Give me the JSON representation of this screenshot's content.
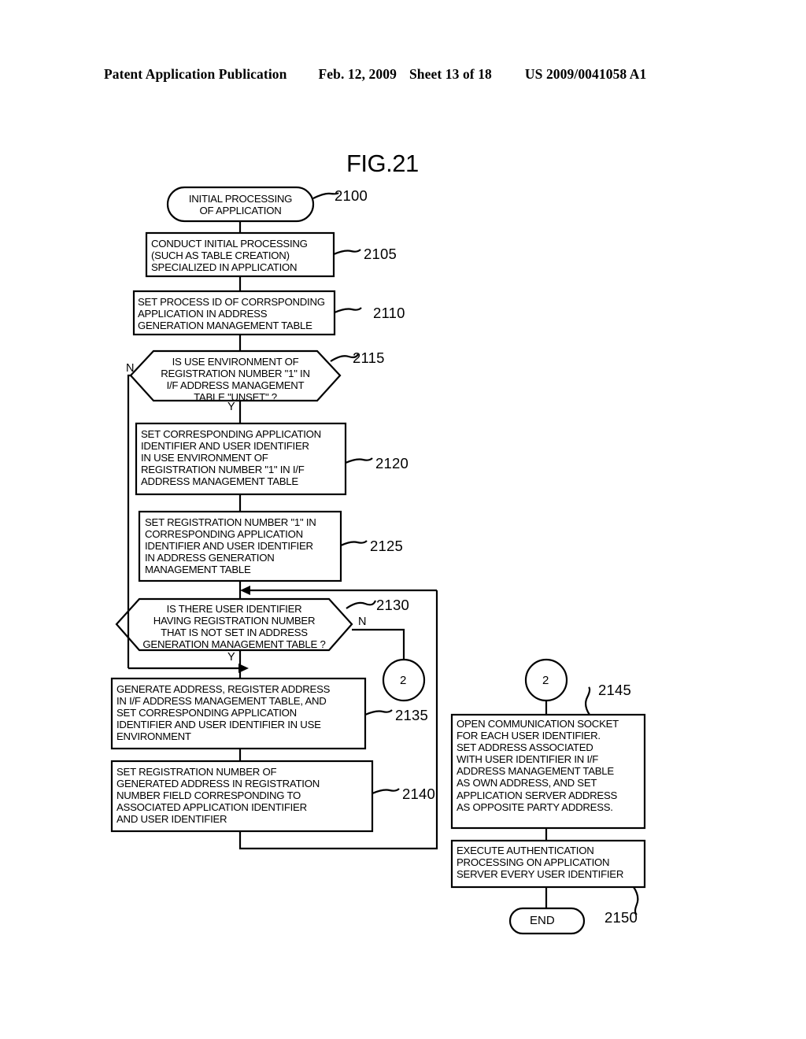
{
  "header": {
    "publication": "Patent Application Publication",
    "date": "Feb. 12, 2009",
    "sheet": "Sheet 13 of 18",
    "doc_number": "US 2009/0041058 A1"
  },
  "figure": {
    "title": "FIG.21",
    "nodes": {
      "start": {
        "ref": "2100",
        "shape": "terminator",
        "text": "INITIAL PROCESSING\nOF APPLICATION"
      },
      "step_2105": {
        "ref": "2105",
        "shape": "process",
        "text": "CONDUCT INITIAL PROCESSING\n(SUCH AS TABLE CREATION)\nSPECIALIZED IN APPLICATION"
      },
      "step_2110": {
        "ref": "2110",
        "shape": "process",
        "text": "SET PROCESS ID OF CORRSPONDING\nAPPLICATION IN ADDRESS\nGENERATION MANAGEMENT TABLE"
      },
      "decision_2115": {
        "ref": "2115",
        "shape": "decision",
        "text": "IS USE ENVIRONMENT OF\nREGISTRATION NUMBER \"1\" IN\nI/F ADDRESS MANAGEMENT\nTABLE \"UNSET\" ?",
        "yes_label": "Y",
        "no_label": "N"
      },
      "step_2120": {
        "ref": "2120",
        "shape": "process",
        "text": "SET CORRESPONDING APPLICATION\nIDENTIFIER AND USER IDENTIFIER\nIN USE ENVIRONMENT OF\nREGISTRATION NUMBER \"1\" IN I/F\nADDRESS MANAGEMENT TABLE"
      },
      "step_2125": {
        "ref": "2125",
        "shape": "process",
        "text": "SET REGISTRATION NUMBER \"1\" IN\nCORRESPONDING APPLICATION\nIDENTIFIER AND USER IDENTIFIER\nIN ADDRESS GENERATION\nMANAGEMENT TABLE"
      },
      "decision_2130": {
        "ref": "2130",
        "shape": "decision",
        "text": "IS THERE USER IDENTIFIER\nHAVING REGISTRATION NUMBER\nTHAT IS NOT SET IN ADDRESS\nGENERATION MANAGEMENT TABLE ?",
        "yes_label": "Y",
        "no_label": "N"
      },
      "step_2135": {
        "ref": "2135",
        "shape": "process",
        "text": "GENERATE ADDRESS, REGISTER ADDRESS\nIN I/F ADDRESS MANAGEMENT TABLE, AND\nSET CORRESPONDING APPLICATION\nIDENTIFIER AND USER IDENTIFIER IN USE\nENVIRONMENT"
      },
      "step_2140": {
        "ref": "2140",
        "shape": "process",
        "text": "SET REGISTRATION NUMBER OF\nGENERATED ADDRESS IN REGISTRATION\nNUMBER FIELD CORRESPONDING TO\nASSOCIATED APPLICATION IDENTIFIER\nAND USER IDENTIFIER"
      },
      "step_2145": {
        "ref": "2145",
        "shape": "process",
        "text": "OPEN COMMUNICATION SOCKET\nFOR EACH USER IDENTIFIER.\nSET ADDRESS ASSOCIATED\nWITH USER IDENTIFIER IN I/F\nADDRESS MANAGEMENT TABLE\nAS OWN ADDRESS, AND SET\nAPPLICATION SERVER ADDRESS\nAS OPPOSITE PARTY ADDRESS."
      },
      "step_auth": {
        "ref": "",
        "shape": "process",
        "text": "EXECUTE AUTHENTICATION\nPROCESSING ON APPLICATION\nSERVER EVERY USER IDENTIFIER"
      },
      "end": {
        "ref": "2150",
        "shape": "terminator",
        "text": "END"
      }
    },
    "connectors": {
      "off_page_source": "2",
      "off_page_target": "2"
    }
  }
}
